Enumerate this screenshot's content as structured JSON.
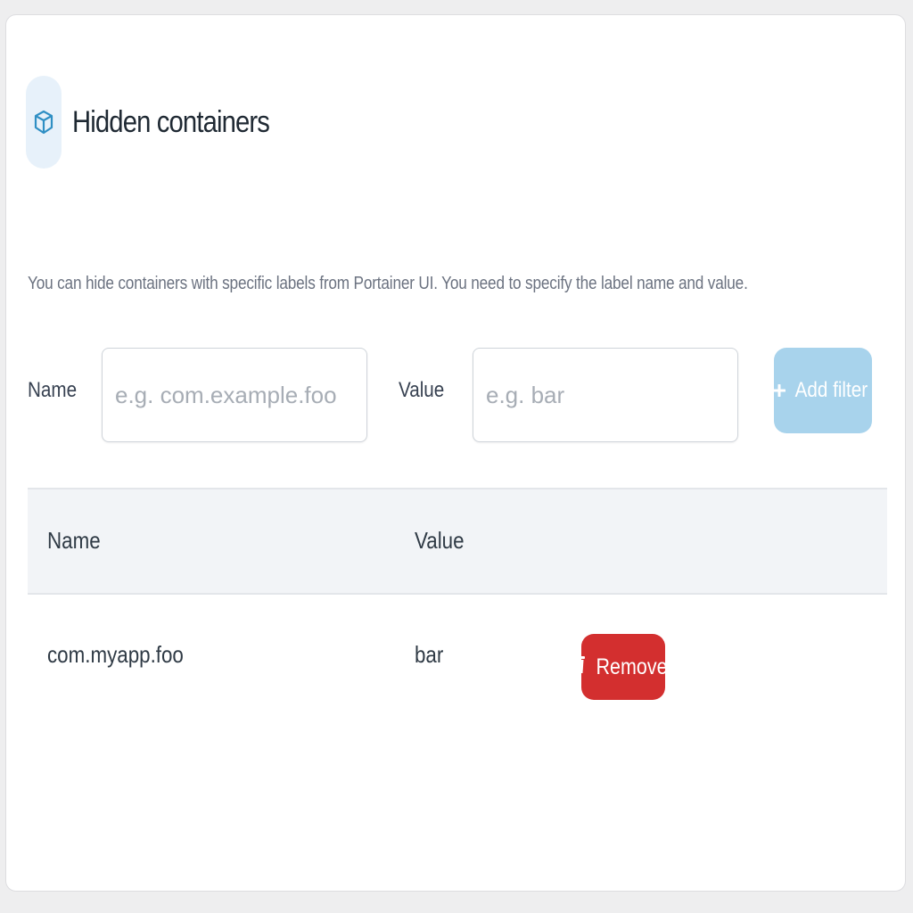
{
  "section": {
    "title": "Hidden containers",
    "icon": "cube-icon",
    "description": "You can hide containers with specific labels from Portainer UI. You need to specify the label name and value."
  },
  "form": {
    "name_label": "Name",
    "name_placeholder": "e.g. com.example.foo",
    "value_label": "Value",
    "value_placeholder": "e.g. bar",
    "add_button_label": "Add filter",
    "add_button_color": "#a8d3ec"
  },
  "table": {
    "headers": [
      "Name",
      "Value"
    ],
    "rows": [
      {
        "name": "com.myapp.foo",
        "value": "bar",
        "action_label": "Remove"
      }
    ],
    "remove_button_color": "#d32f2f"
  }
}
